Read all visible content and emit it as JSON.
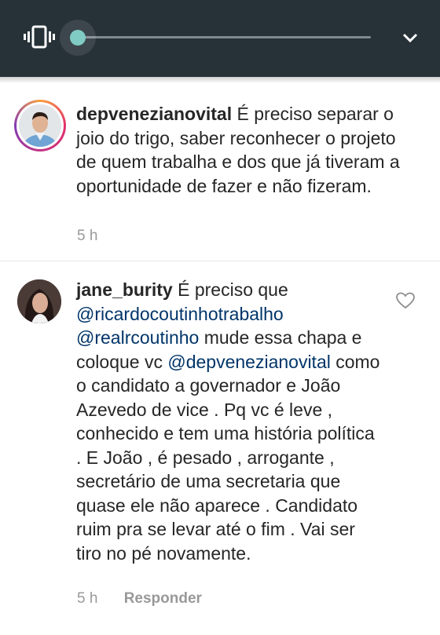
{
  "volume_panel": {
    "mode_icon": "vibrate-icon",
    "expand_icon": "chevron-down-icon",
    "level": 0,
    "accent_color": "#80cbc4",
    "background_color": "#263238"
  },
  "comments": [
    {
      "username": "depvenezianovital",
      "text": "É preciso separar o joio do trigo, saber reconhecer o projeto de quem trabalha e dos que já tiveram a oportunidade de fazer e não fizeram.",
      "time": "5 h"
    },
    {
      "username": "jane_burity",
      "text_start": "É preciso que",
      "mention1": "@ricardocoutinhotrabalho",
      "mention2": "@realrcoutinho",
      "text_middle": "mude essa chapa e coloque vc",
      "mention3": "@depvenezianovital",
      "text_end": "como o candidato a governador e João Azevedo de vice . Pq vc é leve , conhecido e tem uma história política . E João , é pesado , arrogante , secretário de uma secretaria que quase ele não aparece . Candidato ruim pra se levar até o fim . Vai ser tiro no pé novamente.",
      "time": "5 h",
      "reply_label": "Responder",
      "like_icon": "heart-outline-icon"
    }
  ]
}
